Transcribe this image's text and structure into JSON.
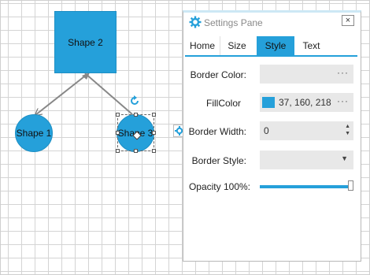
{
  "diagram": {
    "shape1_label": "Shape 1",
    "shape2_label": "Shape 2",
    "shape3_label": "Shape 3"
  },
  "colors": {
    "shape_fill": "#25a0da",
    "accent": "#25a0da",
    "fill_swatch": "#25a0da"
  },
  "pane": {
    "title": "Settings Pane",
    "close_label": "×",
    "tabs": [
      {
        "label": "Home"
      },
      {
        "label": "Size"
      },
      {
        "label": "Style"
      },
      {
        "label": "Text"
      }
    ],
    "active_tab": "Style",
    "border_color": {
      "label": "Border Color:",
      "value": "",
      "button": "···"
    },
    "fill_color": {
      "label": "FillColor",
      "value": "37, 160, 218",
      "button": "···"
    },
    "border_width": {
      "label": "Border Width:",
      "value": "0"
    },
    "border_style": {
      "label": "Border Style:",
      "value": ""
    },
    "opacity": {
      "label": "Opacity 100%:",
      "percent": 100
    }
  },
  "icons": {
    "pane_gear": "gear-icon",
    "side_gear": "gear-icon",
    "rotate": "rotate-icon",
    "close": "close-icon",
    "spin": "spin-arrows-icon",
    "dropdown": "chevron-down-icon"
  }
}
